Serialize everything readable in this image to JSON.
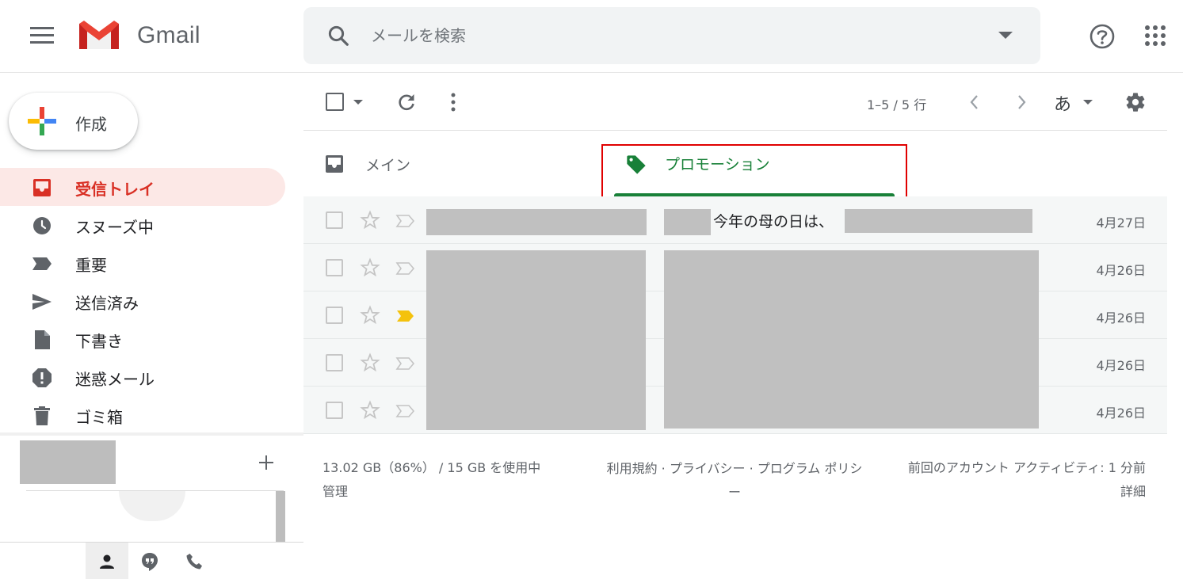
{
  "header": {
    "app_name": "Gmail",
    "search_placeholder": "メールを検索"
  },
  "sidebar": {
    "compose_label": "作成",
    "items": [
      {
        "label": "受信トレイ",
        "icon": "inbox-icon",
        "active": true
      },
      {
        "label": "スヌーズ中",
        "icon": "clock-icon"
      },
      {
        "label": "重要",
        "icon": "important-icon"
      },
      {
        "label": "送信済み",
        "icon": "send-icon"
      },
      {
        "label": "下書き",
        "icon": "draft-icon"
      },
      {
        "label": "迷惑メール",
        "icon": "spam-icon"
      },
      {
        "label": "ゴミ箱",
        "icon": "trash-icon"
      }
    ]
  },
  "toolbar": {
    "pager": "1–5 / 5 行",
    "input_tool": "あ"
  },
  "tabs": {
    "primary": "メイン",
    "promotions": "プロモーション"
  },
  "emails": [
    {
      "subject": "今年の母の日は、",
      "date": "4月27日",
      "important": false
    },
    {
      "subject": "",
      "date": "4月26日",
      "important": false
    },
    {
      "subject": "",
      "date": "4月26日",
      "important": true
    },
    {
      "subject": "",
      "date": "4月26日",
      "important": false
    },
    {
      "subject": "",
      "date": "4月26日",
      "important": false
    }
  ],
  "footer": {
    "storage": "13.02 GB（86%） / 15 GB を使用中",
    "manage": "管理",
    "terms": "利用規約 · プライバシー · プログラム ポリシー",
    "activity": "前回のアカウント アクティビティ: 1 分前",
    "details": "詳細"
  },
  "colors": {
    "accent_red": "#d93025",
    "promo_green": "#188038",
    "highlight_box": "#e00000",
    "important_yellow": "#f4c20d"
  }
}
